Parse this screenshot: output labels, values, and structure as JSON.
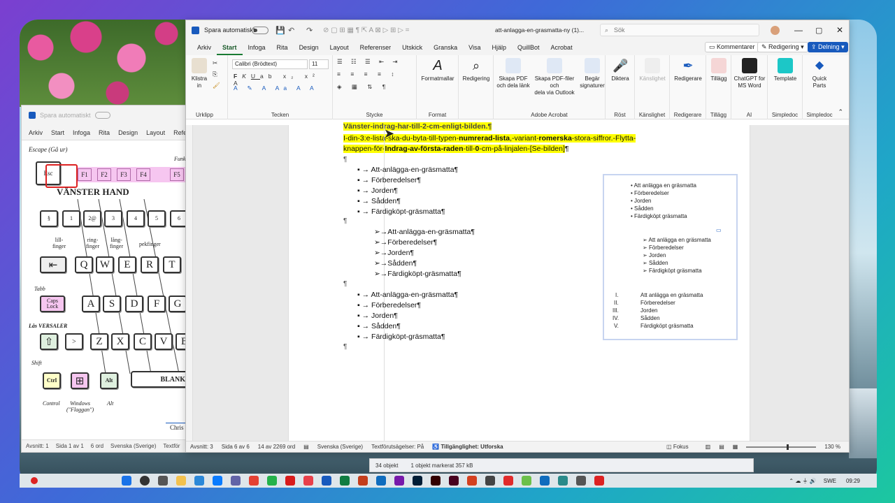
{
  "left_window": {
    "autosave_label": "Spara automatiskt",
    "menu": [
      "Arkiv",
      "Start",
      "Infoga",
      "Rita",
      "Design",
      "Layout",
      "Refer"
    ],
    "escape_label": "Escape (Gå ur)",
    "func_label": "Funk",
    "hand_title": "VÄNSTER HAND",
    "fkeys": [
      "F1",
      "F2",
      "F3",
      "F4",
      "F5"
    ],
    "esc_key": "Esc",
    "num_keys_top": [
      "½",
      "!",
      "\"",
      "#",
      "¤",
      "%",
      "&"
    ],
    "num_keys_bottom": [
      "§",
      "1",
      "2@",
      "3",
      "4",
      "5",
      "6"
    ],
    "fingers": [
      "lill-\nfinger",
      "ring-\nfinger",
      "lång-\nfinger",
      "pekfinger"
    ],
    "row_q": [
      "Q",
      "W",
      "E",
      "R",
      "T"
    ],
    "row_a": [
      "A",
      "S",
      "D",
      "F",
      "G"
    ],
    "row_z": [
      "Z",
      "X",
      "C",
      "V",
      "B"
    ],
    "tabb": "Tabb",
    "caps": "Caps\nLock",
    "las_versaler": "Lås VERSALER",
    "shift": "Shift",
    "ctrl": "Ctrl",
    "alt": "Alt",
    "blank": "BLANK",
    "labels_bottom": [
      "Control",
      "Windows\n(\"Flaggan\")",
      "Alt"
    ],
    "chris": "Chris",
    "status": [
      "Avsnitt: 1",
      "Sida 1 av 1",
      "6 ord",
      "Svenska (Sverige)",
      "Textför"
    ]
  },
  "main_window": {
    "autosave_label": "Spara automatiskt",
    "doc_title": "att-anlagga-en-grasmatta-ny (1)...",
    "search_placeholder": "Sök",
    "menu": [
      "Arkiv",
      "Start",
      "Infoga",
      "Rita",
      "Design",
      "Layout",
      "Referenser",
      "Utskick",
      "Granska",
      "Visa",
      "Hjälp",
      "QuillBot",
      "Acrobat"
    ],
    "comments_btn": "Kommentarer",
    "editing_btn": "Redigering",
    "share_btn": "Delning",
    "ribbon": {
      "paste": "Klistra\nin",
      "font_name": "Calibri (Brödtext)",
      "font_size": "11",
      "groups": [
        "Urklipp",
        "Tecken",
        "Stycke",
        "Format",
        "Adobe Acrobat",
        "Röst",
        "Känslighet",
        "Redigerare",
        "Tillägg",
        "AI",
        "Simpledoc",
        "Simpledoc"
      ],
      "format_templates": "Formatmallar",
      "redigering": "Redigering",
      "pdf_link": "Skapa PDF\noch dela länk",
      "pdf_outlook": "Skapa PDF-filer och\ndela via Outlook",
      "signatures": "Begär\nsignaturer",
      "dictate": "Diktera",
      "sensitivity": "Känslighet",
      "editor": "Redigerare",
      "addins": "Tillägg",
      "chatgpt": "ChatGPT for\nMS Word",
      "template": "Template",
      "quick_parts": "Quick\nParts"
    },
    "document": {
      "line0": "Vänster-indrag-har-till-2-cm-enligt-bilden.¶",
      "line1a": "I-din-3:e-lista-ska-du-byta-till-typen-",
      "line1b": "numrerad-lista",
      "line1c": ",-variant-",
      "line1d": "romerska",
      "line1e": "-stora-siffror.-Flytta-",
      "line2a": "knappen-för-",
      "line2b": "Indrag-av-första-raden",
      "line2c": "-till-",
      "line2d": "0",
      "line2e": "-cm-på-linjalen-[Se-bilden]",
      "line2f": "¶",
      "para_mark": "¶",
      "list1": [
        "→ Att-anlägga-en-gräsmatta¶",
        "→ Förberedelser¶",
        "→ Jorden¶",
        "→ Sådden¶",
        "→ Färdigköpt-gräsmatta¶"
      ],
      "list2": [
        "➢→Att-anlägga-en-gräsmatta¶",
        "➢→Förberedelser¶",
        "➢→Jorden¶",
        "➢→Sådden¶",
        "➢→Färdigköpt-gräsmatta¶"
      ],
      "list3": [
        "→ Att-anlägga-en-gräsmatta¶",
        "→ Förberedelser¶",
        "→ Jorden¶",
        "→ Sådden¶",
        "→ Färdigköpt-gräsmatta¶"
      ]
    },
    "inset": {
      "list1": [
        "Att anlägga en gräsmatta",
        "Förberedelser",
        "Jorden",
        "Sådden",
        "Färdigköpt gräsmatta"
      ],
      "list2": [
        "Att anlägga en gräsmatta",
        "Förberedelser",
        "Jorden",
        "Sådden",
        "Färdigköpt gräsmatta"
      ],
      "roman": [
        "I.",
        "II.",
        "III.",
        "IV.",
        "V."
      ],
      "list3": [
        "Att anlägga en gräsmatta",
        "Förberedelser",
        "Jorden",
        "Sådden",
        "Färdigköpt gräsmatta"
      ]
    },
    "status": {
      "section": "Avsnitt: 3",
      "page": "Sida 6 av 6",
      "words": "14 av 2269 ord",
      "language": "Svenska (Sverige)",
      "predictions": "Textförutsägelser: På",
      "accessibility": "Tillgänglighet: Utforska",
      "focus": "Fokus",
      "zoom": "130 %"
    }
  },
  "explorer": {
    "objects": "34 objekt",
    "selected": "1 objekt markerat  357 kB"
  },
  "taskbar": {
    "time": "09:29",
    "lang": "SWE"
  },
  "colors": {
    "highlight": "#ffff00",
    "word_blue": "#185abd",
    "accent_green": "#1a7b33"
  }
}
